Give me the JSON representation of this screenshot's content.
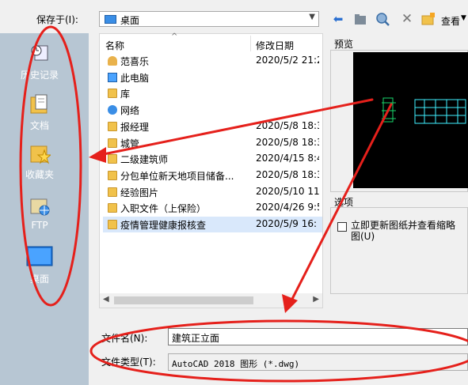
{
  "toolbar": {
    "save_in_label": "保存于(I):",
    "location": "桌面",
    "view_label": "查看"
  },
  "places": [
    {
      "label": "历史记录",
      "icon": "history-icon"
    },
    {
      "label": "文档",
      "icon": "documents-icon"
    },
    {
      "label": "收藏夹",
      "icon": "favorites-icon"
    },
    {
      "label": "FTP",
      "icon": "ftp-icon"
    },
    {
      "label": "桌面",
      "icon": "desktop-icon"
    }
  ],
  "file_list": {
    "columns": {
      "name": "名称",
      "date": "修改日期"
    },
    "rows": [
      {
        "name": "范喜乐",
        "date": "2020/5/2 21:2",
        "icon": "user-folder-icon"
      },
      {
        "name": "此电脑",
        "date": "",
        "icon": "computer-icon"
      },
      {
        "name": "库",
        "date": "",
        "icon": "library-icon"
      },
      {
        "name": "网络",
        "date": "",
        "icon": "network-icon"
      },
      {
        "name": "报经理",
        "date": "2020/5/8 18:3",
        "icon": "folder-icon"
      },
      {
        "name": "城管",
        "date": "2020/5/8 18:3",
        "icon": "folder-icon"
      },
      {
        "name": "二级建筑师",
        "date": "2020/4/15 8:4",
        "icon": "folder-icon"
      },
      {
        "name": "分包单位新天地项目储备...",
        "date": "2020/5/8 18:3",
        "icon": "folder-icon"
      },
      {
        "name": "经验图片",
        "date": "2020/5/10 11",
        "icon": "folder-icon"
      },
      {
        "name": "入职文件（上保险）",
        "date": "2020/4/26 9:5",
        "icon": "folder-icon"
      },
      {
        "name": "疫情管理健康报核查",
        "date": "2020/5/9 16:",
        "icon": "folder-icon"
      }
    ]
  },
  "preview": {
    "label": "预览"
  },
  "options": {
    "label": "选项",
    "update_thumbnail": "立即更新图纸并查看缩略图(U)"
  },
  "bottom": {
    "filename_label": "文件名(N):",
    "filename_value": "建筑正立面",
    "filetype_label": "文件类型(T):",
    "filetype_value": "AutoCAD 2018 图形 (*.dwg)"
  },
  "colors": {
    "places_bg": "#b7c6d3",
    "annotation": "#e5201b",
    "selected_row": "#d9e8fb"
  }
}
